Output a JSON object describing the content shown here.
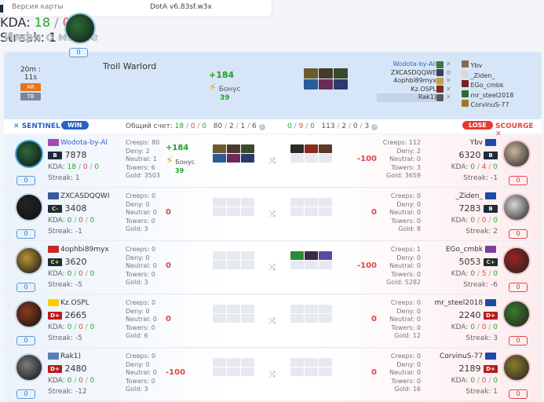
{
  "map_info": {
    "label": "Версия карты",
    "value": "DotA v6.83sf.w3x"
  },
  "section_title": "Инфа о матче",
  "summary": {
    "time": "20m : 11s",
    "mode1": "AR",
    "mode2": "TB",
    "hero": "Troll Warlord",
    "rank": "B",
    "rating": "7878",
    "kda_label": "KDA: ",
    "kda_k": "18",
    "kda_d": "0",
    "kda_a": "0",
    "streak": "Streak: 1",
    "zero": "0",
    "delta": "+184",
    "bonus_label": "Бонус",
    "bonus_value": "39",
    "sentinel_players": [
      "Wodota-by-Ali",
      "ZXCASDQQWE",
      "4ophbi89myx",
      "Kz.OSPL",
      "Rak1)"
    ],
    "scourge_players": [
      "Ybv",
      "_Ziden_",
      "EGo_cmbk",
      "mr_steel2018",
      "CorvinuS-77"
    ]
  },
  "teams": {
    "sentinel": "SENTINEL",
    "win": "WIN",
    "score_label": "Общий счет:",
    "score_s_k": "18",
    "score_s_d": "0",
    "score_s_a": "0",
    "score_s2": "80",
    "score_s3": "2",
    "score_s4": "1",
    "score_s5": "6",
    "score_c_k": "0",
    "score_c_d": "9",
    "score_c_a": "0",
    "score_c2": "113",
    "score_c3": "2",
    "score_c4": "0",
    "score_c5": "3",
    "lose": "LOSE",
    "scourge": "SCOURGE"
  },
  "rows": [
    {
      "l_name": "Wodota-by-Al",
      "l_rank": "B",
      "l_rating": "7878",
      "l_k": "18",
      "l_d": "0",
      "l_a": "0",
      "l_streak": "Streak: 1",
      "l_zero": "0",
      "l_stats": [
        "Creeps: 80",
        "Deny: 2",
        "Neutral: 1",
        "Towers: 6",
        "Gold: 3503"
      ],
      "l_delta": "+184",
      "l_bonus_label": "Бонус",
      "l_bonus": "39",
      "r_delta": "-100",
      "r_stats": [
        "Creeps: 112",
        "Deny: 2",
        "Neutral: 0",
        "Towers: 3",
        "Gold: 3659"
      ],
      "r_name": "Ybv",
      "r_rank": "B",
      "r_rating": "6320",
      "r_k": "0",
      "r_d": "4",
      "r_a": "0",
      "r_streak": "Streak: -1",
      "r_zero": "0"
    },
    {
      "l_name": "ZXCASDQQWI",
      "l_rank": "C-",
      "l_rating": "3408",
      "l_k": "0",
      "l_d": "0",
      "l_a": "0",
      "l_streak": "Streak: -1",
      "l_zero": "0",
      "l_stats": [
        "Creeps: 0",
        "Deny: 0",
        "Neutral: 0",
        "Towers: 0",
        "Gold: 3"
      ],
      "l_delta": "0",
      "r_delta": "0",
      "r_stats": [
        "Creeps: 0",
        "Deny: 0",
        "Neutral: 0",
        "Towers: 0",
        "Gold: 8"
      ],
      "r_name": "_Ziden_",
      "r_rank": "B",
      "r_rating": "7283",
      "r_k": "0",
      "r_d": "0",
      "r_a": "0",
      "r_streak": "Streak: 2",
      "r_zero": "0"
    },
    {
      "l_name": "4ophbi89myx",
      "l_rank": "C+",
      "l_rating": "3620",
      "l_k": "0",
      "l_d": "0",
      "l_a": "0",
      "l_streak": "Streak: -5",
      "l_zero": "0",
      "l_stats": [
        "Creeps: 0",
        "Deny: 0",
        "Neutral: 0",
        "Towers: 0",
        "Gold: 3"
      ],
      "l_delta": "0",
      "r_delta": "-100",
      "r_stats": [
        "Creeps: 1",
        "Deny: 0",
        "Neutral: 0",
        "Towers: 0",
        "Gold: 5282"
      ],
      "r_name": "EGo_cmbk",
      "r_rank": "C+",
      "r_rating": "5053",
      "r_k": "0",
      "r_d": "5",
      "r_a": "0",
      "r_streak": "Streak: -6",
      "r_zero": "0"
    },
    {
      "l_name": "Kz.OSPL",
      "l_rank": "D+",
      "l_rating": "2665",
      "l_k": "0",
      "l_d": "0",
      "l_a": "0",
      "l_streak": "Streak: -5",
      "l_zero": "0",
      "l_stats": [
        "Creeps: 0",
        "Deny: 0",
        "Neutral: 0",
        "Towers: 0",
        "Gold: 6"
      ],
      "l_delta": "0",
      "r_delta": "0",
      "r_stats": [
        "Creeps: 0",
        "Deny: 0",
        "Neutral: 0",
        "Towers: 0",
        "Gold: 12"
      ],
      "r_name": "mr_steel2018",
      "r_rank": "D+",
      "r_rating": "2240",
      "r_k": "0",
      "r_d": "0",
      "r_a": "0",
      "r_streak": "Streak: 3",
      "r_zero": "0"
    },
    {
      "l_name": "Rak1)",
      "l_rank": "D+",
      "l_rating": "2480",
      "l_k": "0",
      "l_d": "0",
      "l_a": "0",
      "l_streak": "Streak: -12",
      "l_zero": "0",
      "l_stats": [
        "Creeps: 0",
        "Deny: 0",
        "Neutral: 0",
        "Towers: 0",
        "Gold: 3"
      ],
      "l_delta": "-100",
      "r_delta": "0",
      "r_stats": [
        "Creeps: 0",
        "Deny: 0",
        "Neutral: 0",
        "Towers: 0",
        "Gold: 16"
      ],
      "r_name": "CorvinuS-77",
      "r_rank": "D+",
      "r_rating": "2189",
      "r_k": "0",
      "r_d": "0",
      "r_a": "0",
      "r_streak": "Streak: 1",
      "r_zero": "0"
    }
  ]
}
